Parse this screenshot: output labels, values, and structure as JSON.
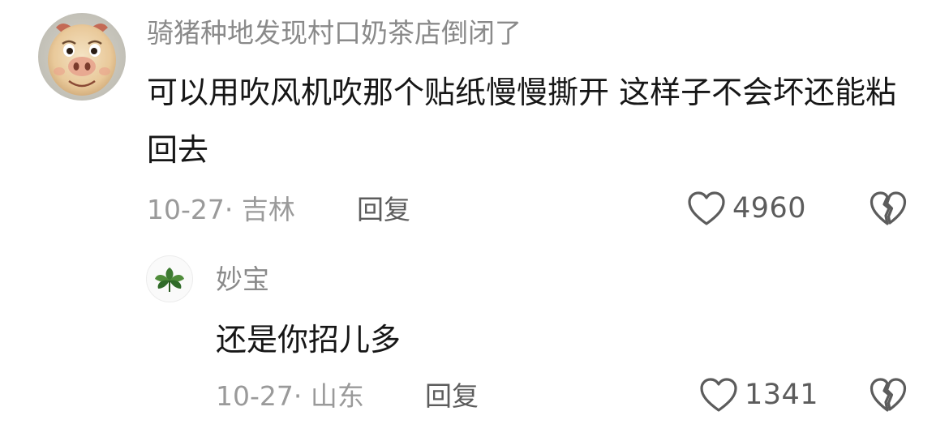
{
  "comments": [
    {
      "username": "骑猪种地发现村口奶茶店倒闭了",
      "content": "可以用吹风机吹那个贴纸慢慢撕开 这样子不会坏还能粘回去",
      "meta": "10-27· 吉林",
      "reply_label": "回复",
      "like_count": "4960",
      "avatar_icon": "pig-avatar-icon"
    },
    {
      "username": "妙宝",
      "content": "还是你招儿多",
      "meta": "10-27· 山东",
      "reply_label": "回复",
      "like_count": "1341",
      "avatar_icon": "green-leaf-avatar-icon"
    }
  ],
  "colors": {
    "background": "#ffffff",
    "username": "#8a8a8a",
    "content": "#161616",
    "meta": "#9a9a9a",
    "action": "#5c5c5c"
  }
}
